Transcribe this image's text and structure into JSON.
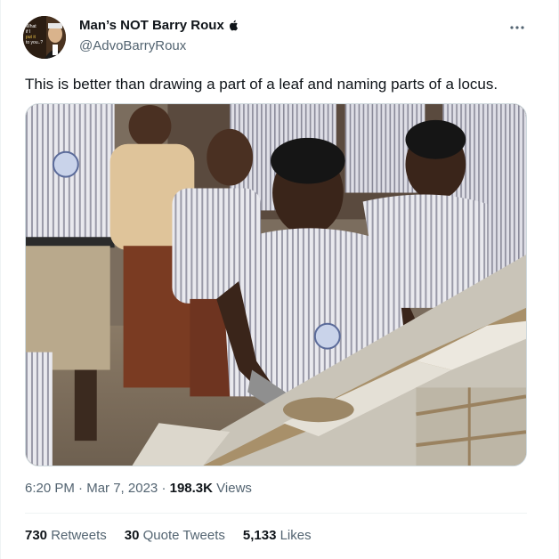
{
  "author": {
    "display_name": "Man’s NOT Barry Roux",
    "handle": "@AdvoBarryRoux",
    "avatar_text": "What if I put it to you...?"
  },
  "tweet": {
    "text": "This is better than drawing a part of a leaf and naming parts of a locus.",
    "media_alt": "Students in striped school uniforms laying concrete blocks with a trowel"
  },
  "meta": {
    "time": "6:20 PM",
    "separator": "·",
    "date": "Mar 7, 2023",
    "views_count": "198.3K",
    "views_label": "Views"
  },
  "stats": [
    {
      "count": "730",
      "label": "Retweets"
    },
    {
      "count": "30",
      "label": "Quote Tweets"
    },
    {
      "count": "5,133",
      "label": "Likes"
    }
  ],
  "icons": {
    "more": "more-horizontal-icon",
    "apple": "apple-logo-icon"
  },
  "colors": {
    "text_primary": "#0f1419",
    "text_secondary": "#536471",
    "border": "#eff3f4"
  }
}
